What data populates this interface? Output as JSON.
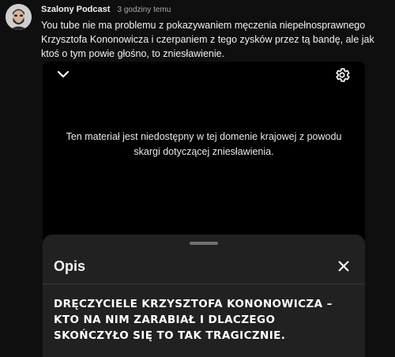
{
  "comment": {
    "author": "Szalony Podcast",
    "time": "3 godziny temu",
    "text": "You tube nie ma problemu z pokazywaniem męczenia niepełnosprawnego Krzysztofa Kononowicza i czerpaniem z tego zysków przez tą bandę, ale jak ktoś o tym powie głośno, to zniesławienie."
  },
  "player": {
    "message": "Ten materiał jest niedostępny w tej domenie krajowej z powodu skargi dotyczącej zniesławienia.",
    "collapse_icon": "chevron-down-icon",
    "settings_icon": "gear-icon"
  },
  "description_sheet": {
    "title": "Opis",
    "close_icon": "close-icon",
    "text": "DRĘCZYCIELE KRZYSZTOFA KONONOWICZA – KTO NA NIM ZARABIAŁ I DLACZEGO SKOŃCZYŁO SIĘ TO TAK TRAGICZNIE."
  },
  "colors": {
    "background": "#0f0f0f",
    "player": "#000000",
    "sheet": "#212121",
    "secondary_text": "#aaaaaa"
  }
}
